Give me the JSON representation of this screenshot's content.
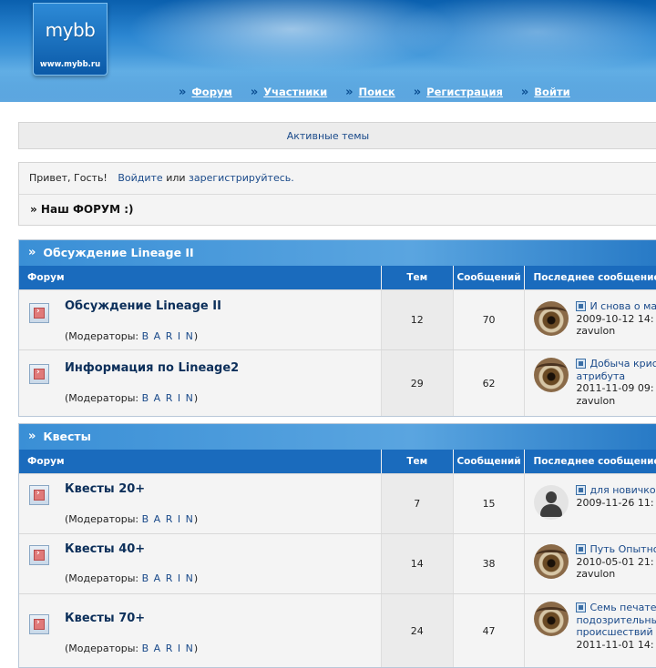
{
  "header": {
    "logo_text": "mybb",
    "logo_url": "www.mybb.ru",
    "nav": [
      "Форум",
      "Участники",
      "Поиск",
      "Регистрация",
      "Войти"
    ]
  },
  "active_topics": "Активные темы",
  "welcome": {
    "greeting": "Привет, Гость!",
    "login": "Войдите",
    "or": "или",
    "register": "зарегистрируйтесь."
  },
  "forum_heading": "» Наш ФОРУМ :)",
  "columns": {
    "forum": "Форум",
    "topics": "Тем",
    "posts": "Сообщений",
    "last": "Последнее сообщение"
  },
  "categories": [
    {
      "title": "Обсуждение Lineage II",
      "forums": [
        {
          "name": "Обсуждение Lineage II",
          "mods_label": "(Модераторы: ",
          "mods": "B A R I N",
          "mods_end": ")",
          "topics": "12",
          "posts": "70",
          "avatar": "eye",
          "last_lines": [
            "И снова о ма",
            "2009-10-12 14:",
            "zavulon"
          ]
        },
        {
          "name": "Информация по Lineage2",
          "mods_label": "(Модераторы: ",
          "mods": "B A R I N",
          "mods_end": ")",
          "topics": "29",
          "posts": "62",
          "avatar": "eye",
          "last_lines": [
            "Добыча крис",
            "атрибута",
            "2011-11-09 09:",
            "zavulon"
          ]
        }
      ]
    },
    {
      "title": "Квесты",
      "forums": [
        {
          "name": "Квесты 20+",
          "mods_label": "(Модераторы: ",
          "mods": "B A R I N",
          "mods_end": ")",
          "topics": "7",
          "posts": "15",
          "avatar": "person",
          "last_lines": [
            "для новичко",
            "2009-11-26 11:"
          ]
        },
        {
          "name": "Квесты 40+",
          "mods_label": "(Модераторы: ",
          "mods": "B A R I N",
          "mods_end": ")",
          "topics": "14",
          "posts": "38",
          "avatar": "eye",
          "last_lines": [
            "Путь Опытно",
            "2010-05-01 21:",
            "zavulon"
          ]
        },
        {
          "name": "Квесты 70+",
          "mods_label": "(Модераторы: ",
          "mods": "B A R I N",
          "mods_end": ")",
          "topics": "24",
          "posts": "47",
          "avatar": "eye",
          "last_lines": [
            "Семь печате",
            "подозрительны",
            "происшествий",
            "2011-11-01 14:"
          ]
        }
      ]
    }
  ],
  "colors": {
    "header_blue": "#2b86d1",
    "column_head": "#1a6bbd",
    "link": "#1a4a8a"
  }
}
